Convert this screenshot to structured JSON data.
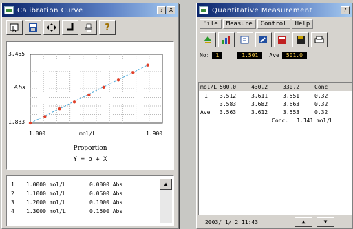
{
  "left_window": {
    "title": "Calibration Curve",
    "title_buttons": [
      "?",
      "X"
    ],
    "toolbar_icons": [
      "pointer-tool-icon",
      "save-icon",
      "move-icon",
      "corner-icon",
      "print-icon",
      "help-icon"
    ],
    "chart": {
      "ylabel": "Abs",
      "y_top": "3.455",
      "y_bottom": "1.833",
      "x_left": "1.000",
      "x_right": "1.900",
      "xlabel": "mol/L"
    },
    "proportion_label": "Proportion",
    "formula": "Y = b + X",
    "list_rows": [
      {
        "idx": "1",
        "conc": "1.0000 mol/L",
        "abs": "0.0000 Abs"
      },
      {
        "idx": "2",
        "conc": "1.1000 mol/L",
        "abs": "0.0500 Abs"
      },
      {
        "idx": "3",
        "conc": "1.2000 mol/L",
        "abs": "0.1000 Abs"
      },
      {
        "idx": "4",
        "conc": "1.3000 mol/L",
        "abs": "0.1500 Abs"
      }
    ]
  },
  "chart_data": {
    "type": "scatter",
    "x": [
      1.0,
      1.1,
      1.2,
      1.3,
      1.4,
      1.5,
      1.6,
      1.7,
      1.8
    ],
    "y": [
      1.833,
      1.99,
      2.17,
      2.33,
      2.5,
      2.68,
      2.85,
      3.03,
      3.2
    ],
    "xlabel": "mol/L",
    "ylabel": "Abs",
    "xlim": [
      1.0,
      1.9
    ],
    "ylim": [
      1.833,
      3.455
    ],
    "grid": true,
    "fit_line": true,
    "point_color": "#e0402a",
    "line_color": "#4aa8d8"
  },
  "right_window": {
    "title": "Quantitative Measurement",
    "menus": [
      "File",
      "Measure",
      "Control",
      "Help"
    ],
    "toolbar_icons": [
      "green-arrows-icon",
      "chart-icon",
      "open-icon",
      "edit-icon",
      "calculator-icon",
      "floppy-icon",
      "print-icon"
    ],
    "status": {
      "no_label": "No:",
      "no_value": "1",
      "reading": "1.501",
      "avg_label": "Ave",
      "avg_value": "501.0"
    },
    "table": {
      "headers": [
        "mol/L",
        "500.0",
        "430.2",
        "330.2",
        "Conc"
      ],
      "rows": [
        [
          "1",
          "3.512",
          "3.611",
          "3.551",
          "0.32"
        ],
        [
          "",
          "3.583",
          "3.682",
          "3.663",
          "0.32"
        ],
        [
          "Ave",
          "3.563",
          "3.612",
          "3.553",
          "0.32"
        ]
      ],
      "conc_label": "Conc.",
      "conc_value": "1.141 mol/L"
    },
    "footer_date": "2003/ 1/ 2 11:43"
  },
  "colors": {
    "title_start": "#0a246a",
    "title_end": "#a6caf0",
    "window_bg": "#d6d3ce",
    "desktop": "#c8c8c4"
  }
}
